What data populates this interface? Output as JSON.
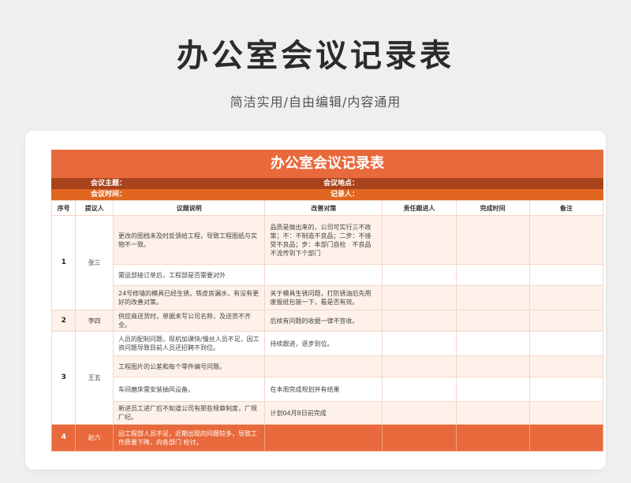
{
  "page_title": "办公室会议记录表",
  "page_subtitle": "简洁实用/自由编辑/内容通用",
  "sheet": {
    "title": "办公室会议记录表",
    "meta": {
      "topic_label": "会议主题：",
      "place_label": "会议地点：",
      "time_label": "会议时间：",
      "recorder_label": "记录人："
    },
    "headers": [
      "序号",
      "提议人",
      "议题说明",
      "改善对策",
      "责任跟进人",
      "完成时间",
      "备注"
    ],
    "groups": [
      {
        "num": "1",
        "person": "张三",
        "rows": [
          {
            "issue": "更改的图档未及时反馈给工程，导致工程图纸与实物不一致。",
            "measure": "品质是做出来的，公司可实行三不政策；不：不制造不良品；二步：不接受不良品；步：本部门自检　不良品不流传到下个部门"
          },
          {
            "issue": "需运部接订单后，工程部是否需要对外",
            "measure": ""
          },
          {
            "issue": "24号修墙的模具已经生锈，铁皮房漏水，有没有更好的改善对策。",
            "measure": "关于模具生锈问题，打防锈油后先用废报纸包装一下，看是否有效。"
          }
        ]
      },
      {
        "num": "2",
        "person": "李四",
        "rows": [
          {
            "issue": "供应商送货时，单据未写公司名称，及送货不齐全。",
            "measure": "后续有问题的收据一律不签收。"
          }
        ]
      },
      {
        "num": "3",
        "person": "王五",
        "rows": [
          {
            "issue": "人员的配制问题，现机加课快/慢丝人员不足，因工资问题导致目前人员还招聘不到位。",
            "measure": "持续跟进，逐步到位。"
          },
          {
            "issue": "工程图片的公差和每个零件编号问题。",
            "measure": ""
          },
          {
            "issue": "车间磨床需安装抽风设备。",
            "measure": "在本周完成规划并有结果"
          },
          {
            "issue": "新进员工进厂后不知道公司有那些规章制度，厂规厂纪。",
            "measure": "计划04月8日前完成"
          }
        ]
      },
      {
        "num": "4",
        "person": "赵六",
        "rows": [
          {
            "issue": "因工程部人员不足，近期出现的问题较多，导致工作质量下降，向各部门 检讨。",
            "measure": ""
          }
        ]
      }
    ]
  }
}
